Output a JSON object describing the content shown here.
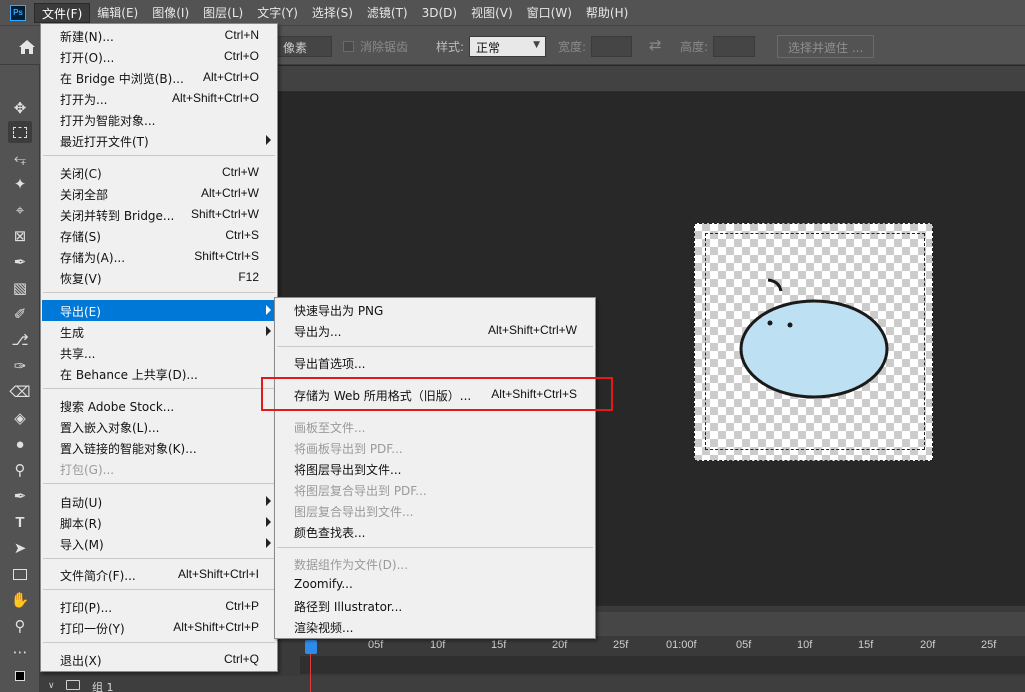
{
  "app": {
    "logo_text": "Ps"
  },
  "menubar": {
    "items": [
      "文件(F)",
      "编辑(E)",
      "图像(I)",
      "图层(L)",
      "文字(Y)",
      "选择(S)",
      "滤镜(T)",
      "3D(D)",
      "视图(V)",
      "窗口(W)",
      "帮助(H)"
    ]
  },
  "options": {
    "feather_unit": "像素",
    "antialias_label": "消除锯齿",
    "style_label": "样式:",
    "style_value": "正常",
    "width_label": "宽度:",
    "height_label": "高度:",
    "select_mask_button": "选择并遮住 ..."
  },
  "file_menu": {
    "items": [
      {
        "label": "新建(N)...",
        "shortcut": "Ctrl+N"
      },
      {
        "label": "打开(O)...",
        "shortcut": "Ctrl+O"
      },
      {
        "label": "在 Bridge 中浏览(B)...",
        "shortcut": "Alt+Ctrl+O"
      },
      {
        "label": "打开为...",
        "shortcut": "Alt+Shift+Ctrl+O"
      },
      {
        "label": "打开为智能对象...",
        "shortcut": ""
      },
      {
        "label": "最近打开文件(T)",
        "shortcut": ""
      },
      {
        "label": "关闭(C)",
        "shortcut": "Ctrl+W"
      },
      {
        "label": "关闭全部",
        "shortcut": "Alt+Ctrl+W"
      },
      {
        "label": "关闭并转到 Bridge...",
        "shortcut": "Shift+Ctrl+W"
      },
      {
        "label": "存储(S)",
        "shortcut": "Ctrl+S"
      },
      {
        "label": "存储为(A)...",
        "shortcut": "Shift+Ctrl+S"
      },
      {
        "label": "恢复(V)",
        "shortcut": "F12"
      },
      {
        "label": "导出(E)",
        "shortcut": ""
      },
      {
        "label": "生成",
        "shortcut": ""
      },
      {
        "label": "共享...",
        "shortcut": ""
      },
      {
        "label": "在 Behance 上共享(D)...",
        "shortcut": ""
      },
      {
        "label": "搜索 Adobe Stock...",
        "shortcut": ""
      },
      {
        "label": "置入嵌入对象(L)...",
        "shortcut": ""
      },
      {
        "label": "置入链接的智能对象(K)...",
        "shortcut": ""
      },
      {
        "label": "打包(G)...",
        "shortcut": ""
      },
      {
        "label": "自动(U)",
        "shortcut": ""
      },
      {
        "label": "脚本(R)",
        "shortcut": ""
      },
      {
        "label": "导入(M)",
        "shortcut": ""
      },
      {
        "label": "文件简介(F)...",
        "shortcut": "Alt+Shift+Ctrl+I"
      },
      {
        "label": "打印(P)...",
        "shortcut": "Ctrl+P"
      },
      {
        "label": "打印一份(Y)",
        "shortcut": "Alt+Shift+Ctrl+P"
      },
      {
        "label": "退出(X)",
        "shortcut": "Ctrl+Q"
      }
    ]
  },
  "export_menu": {
    "items": [
      {
        "label": "快速导出为 PNG",
        "shortcut": ""
      },
      {
        "label": "导出为...",
        "shortcut": "Alt+Shift+Ctrl+W"
      },
      {
        "label": "导出首选项...",
        "shortcut": ""
      },
      {
        "label": "存储为 Web 所用格式（旧版）...",
        "shortcut": "Alt+Shift+Ctrl+S"
      },
      {
        "label": "画板至文件...",
        "shortcut": ""
      },
      {
        "label": "将画板导出到 PDF...",
        "shortcut": ""
      },
      {
        "label": "将图层导出到文件...",
        "shortcut": ""
      },
      {
        "label": "将图层复合导出到 PDF...",
        "shortcut": ""
      },
      {
        "label": "图层复合导出到文件...",
        "shortcut": ""
      },
      {
        "label": "颜色查找表...",
        "shortcut": ""
      },
      {
        "label": "数据组作为文件(D)...",
        "shortcut": ""
      },
      {
        "label": "Zoomify...",
        "shortcut": ""
      },
      {
        "label": "路径到 Illustrator...",
        "shortcut": ""
      },
      {
        "label": "渲染视频...",
        "shortcut": ""
      }
    ]
  },
  "timeline": {
    "ticks": [
      "05f",
      "10f",
      "15f",
      "20f",
      "25f",
      "01:00f",
      "05f",
      "10f",
      "15f",
      "20f",
      "25f"
    ],
    "layer_name": "组 1"
  },
  "colors": {
    "highlight": "#0078d7",
    "annotation": "#e11b1b",
    "blob_fill": "#bde1f2"
  }
}
